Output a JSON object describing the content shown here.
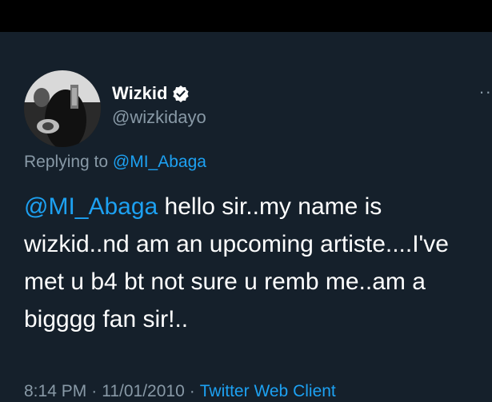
{
  "colors": {
    "background": "#15202b",
    "top_bar": "#000000",
    "primary_text": "#ffffff",
    "secondary_text": "#8899a6",
    "accent": "#1da1f2"
  },
  "tweet": {
    "author": {
      "display_name": "Wizkid",
      "handle": "@wizkidayo",
      "verified_icon": "verified-badge-icon",
      "avatar_icon": "avatar"
    },
    "more_icon": "more-options-icon",
    "reply_context": {
      "prefix": "Replying to ",
      "mention": "@MI_Abaga"
    },
    "text": {
      "mention": "@MI_Abaga",
      "body": " hello sir..my name is wizkid..nd am an upcoming artiste....I've met u b4 bt not sure u remb me..am a bigggg fan sir!.."
    },
    "meta": {
      "time": "8:14 PM",
      "separator": "·",
      "date": "11/01/2010",
      "client": "Twitter Web Client"
    }
  }
}
